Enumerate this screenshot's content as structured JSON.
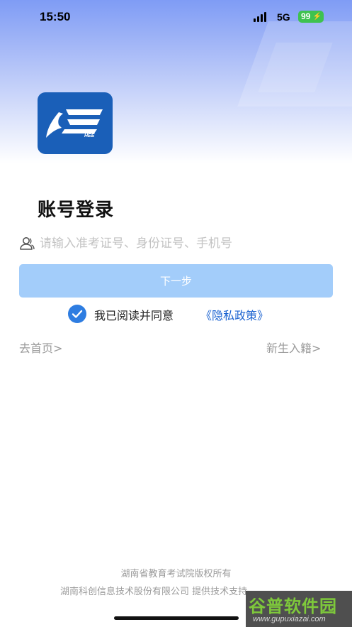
{
  "status_bar": {
    "time": "15:50",
    "network": "5G",
    "battery": "99"
  },
  "logo": {
    "label": "HEE",
    "color": "#1a5fb8"
  },
  "login": {
    "title": "账号登录",
    "account_placeholder": "请输入准考证号、身份证号、手机号",
    "account_value": "",
    "next_label": "下一步",
    "agreement_text": "我已阅读并同意",
    "policy_link": "《隐私政策》",
    "agreement_checked": true,
    "home_link": "去首页>",
    "new_student_link": "新生入籍>"
  },
  "footer": {
    "line1": "湖南省教育考试院版权所有",
    "line2": "湖南科创信息技术股份有限公司 提供技术支持"
  },
  "watermark": {
    "main": "谷普软件园",
    "sub": "www.gupuxiazai.com"
  },
  "colors": {
    "accent": "#2e7de1",
    "button_disabled": "#a3cdfa",
    "link": "#1a62d0"
  }
}
